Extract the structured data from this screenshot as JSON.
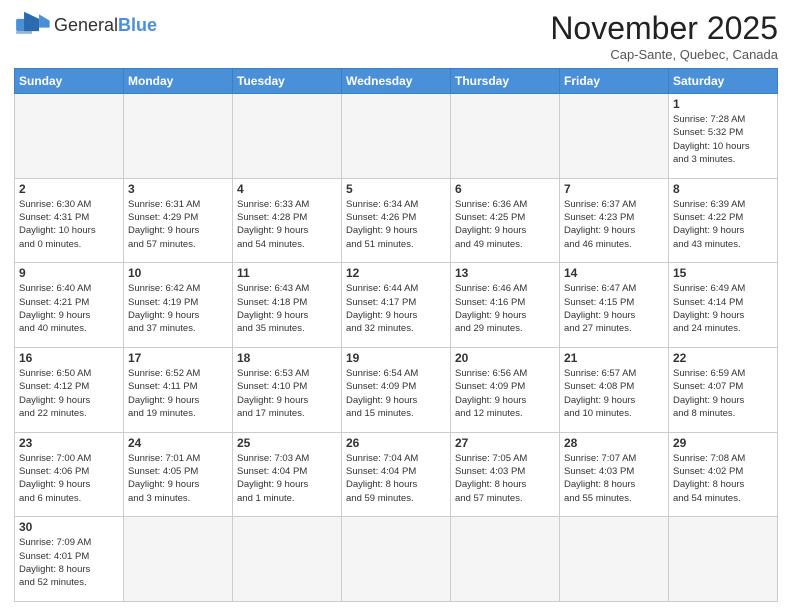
{
  "logo": {
    "text_general": "General",
    "text_blue": "Blue"
  },
  "header": {
    "month_title": "November 2025",
    "subtitle": "Cap-Sante, Quebec, Canada"
  },
  "weekdays": [
    "Sunday",
    "Monday",
    "Tuesday",
    "Wednesday",
    "Thursday",
    "Friday",
    "Saturday"
  ],
  "weeks": [
    [
      {
        "day": "",
        "empty": true
      },
      {
        "day": "",
        "empty": true
      },
      {
        "day": "",
        "empty": true
      },
      {
        "day": "",
        "empty": true
      },
      {
        "day": "",
        "empty": true
      },
      {
        "day": "",
        "empty": true
      },
      {
        "day": "1",
        "info": "Sunrise: 7:28 AM\nSunset: 5:32 PM\nDaylight: 10 hours\nand 3 minutes."
      }
    ],
    [
      {
        "day": "2",
        "info": "Sunrise: 6:30 AM\nSunset: 4:31 PM\nDaylight: 10 hours\nand 0 minutes."
      },
      {
        "day": "3",
        "info": "Sunrise: 6:31 AM\nSunset: 4:29 PM\nDaylight: 9 hours\nand 57 minutes."
      },
      {
        "day": "4",
        "info": "Sunrise: 6:33 AM\nSunset: 4:28 PM\nDaylight: 9 hours\nand 54 minutes."
      },
      {
        "day": "5",
        "info": "Sunrise: 6:34 AM\nSunset: 4:26 PM\nDaylight: 9 hours\nand 51 minutes."
      },
      {
        "day": "6",
        "info": "Sunrise: 6:36 AM\nSunset: 4:25 PM\nDaylight: 9 hours\nand 49 minutes."
      },
      {
        "day": "7",
        "info": "Sunrise: 6:37 AM\nSunset: 4:23 PM\nDaylight: 9 hours\nand 46 minutes."
      },
      {
        "day": "8",
        "info": "Sunrise: 6:39 AM\nSunset: 4:22 PM\nDaylight: 9 hours\nand 43 minutes."
      }
    ],
    [
      {
        "day": "9",
        "info": "Sunrise: 6:40 AM\nSunset: 4:21 PM\nDaylight: 9 hours\nand 40 minutes."
      },
      {
        "day": "10",
        "info": "Sunrise: 6:42 AM\nSunset: 4:19 PM\nDaylight: 9 hours\nand 37 minutes."
      },
      {
        "day": "11",
        "info": "Sunrise: 6:43 AM\nSunset: 4:18 PM\nDaylight: 9 hours\nand 35 minutes."
      },
      {
        "day": "12",
        "info": "Sunrise: 6:44 AM\nSunset: 4:17 PM\nDaylight: 9 hours\nand 32 minutes."
      },
      {
        "day": "13",
        "info": "Sunrise: 6:46 AM\nSunset: 4:16 PM\nDaylight: 9 hours\nand 29 minutes."
      },
      {
        "day": "14",
        "info": "Sunrise: 6:47 AM\nSunset: 4:15 PM\nDaylight: 9 hours\nand 27 minutes."
      },
      {
        "day": "15",
        "info": "Sunrise: 6:49 AM\nSunset: 4:14 PM\nDaylight: 9 hours\nand 24 minutes."
      }
    ],
    [
      {
        "day": "16",
        "info": "Sunrise: 6:50 AM\nSunset: 4:12 PM\nDaylight: 9 hours\nand 22 minutes."
      },
      {
        "day": "17",
        "info": "Sunrise: 6:52 AM\nSunset: 4:11 PM\nDaylight: 9 hours\nand 19 minutes."
      },
      {
        "day": "18",
        "info": "Sunrise: 6:53 AM\nSunset: 4:10 PM\nDaylight: 9 hours\nand 17 minutes."
      },
      {
        "day": "19",
        "info": "Sunrise: 6:54 AM\nSunset: 4:09 PM\nDaylight: 9 hours\nand 15 minutes."
      },
      {
        "day": "20",
        "info": "Sunrise: 6:56 AM\nSunset: 4:09 PM\nDaylight: 9 hours\nand 12 minutes."
      },
      {
        "day": "21",
        "info": "Sunrise: 6:57 AM\nSunset: 4:08 PM\nDaylight: 9 hours\nand 10 minutes."
      },
      {
        "day": "22",
        "info": "Sunrise: 6:59 AM\nSunset: 4:07 PM\nDaylight: 9 hours\nand 8 minutes."
      }
    ],
    [
      {
        "day": "23",
        "info": "Sunrise: 7:00 AM\nSunset: 4:06 PM\nDaylight: 9 hours\nand 6 minutes."
      },
      {
        "day": "24",
        "info": "Sunrise: 7:01 AM\nSunset: 4:05 PM\nDaylight: 9 hours\nand 3 minutes."
      },
      {
        "day": "25",
        "info": "Sunrise: 7:03 AM\nSunset: 4:04 PM\nDaylight: 9 hours\nand 1 minute."
      },
      {
        "day": "26",
        "info": "Sunrise: 7:04 AM\nSunset: 4:04 PM\nDaylight: 8 hours\nand 59 minutes."
      },
      {
        "day": "27",
        "info": "Sunrise: 7:05 AM\nSunset: 4:03 PM\nDaylight: 8 hours\nand 57 minutes."
      },
      {
        "day": "28",
        "info": "Sunrise: 7:07 AM\nSunset: 4:03 PM\nDaylight: 8 hours\nand 55 minutes."
      },
      {
        "day": "29",
        "info": "Sunrise: 7:08 AM\nSunset: 4:02 PM\nDaylight: 8 hours\nand 54 minutes."
      }
    ],
    [
      {
        "day": "30",
        "info": "Sunrise: 7:09 AM\nSunset: 4:01 PM\nDaylight: 8 hours\nand 52 minutes."
      },
      {
        "day": "",
        "empty": true
      },
      {
        "day": "",
        "empty": true
      },
      {
        "day": "",
        "empty": true
      },
      {
        "day": "",
        "empty": true
      },
      {
        "day": "",
        "empty": true
      },
      {
        "day": "",
        "empty": true
      }
    ]
  ]
}
